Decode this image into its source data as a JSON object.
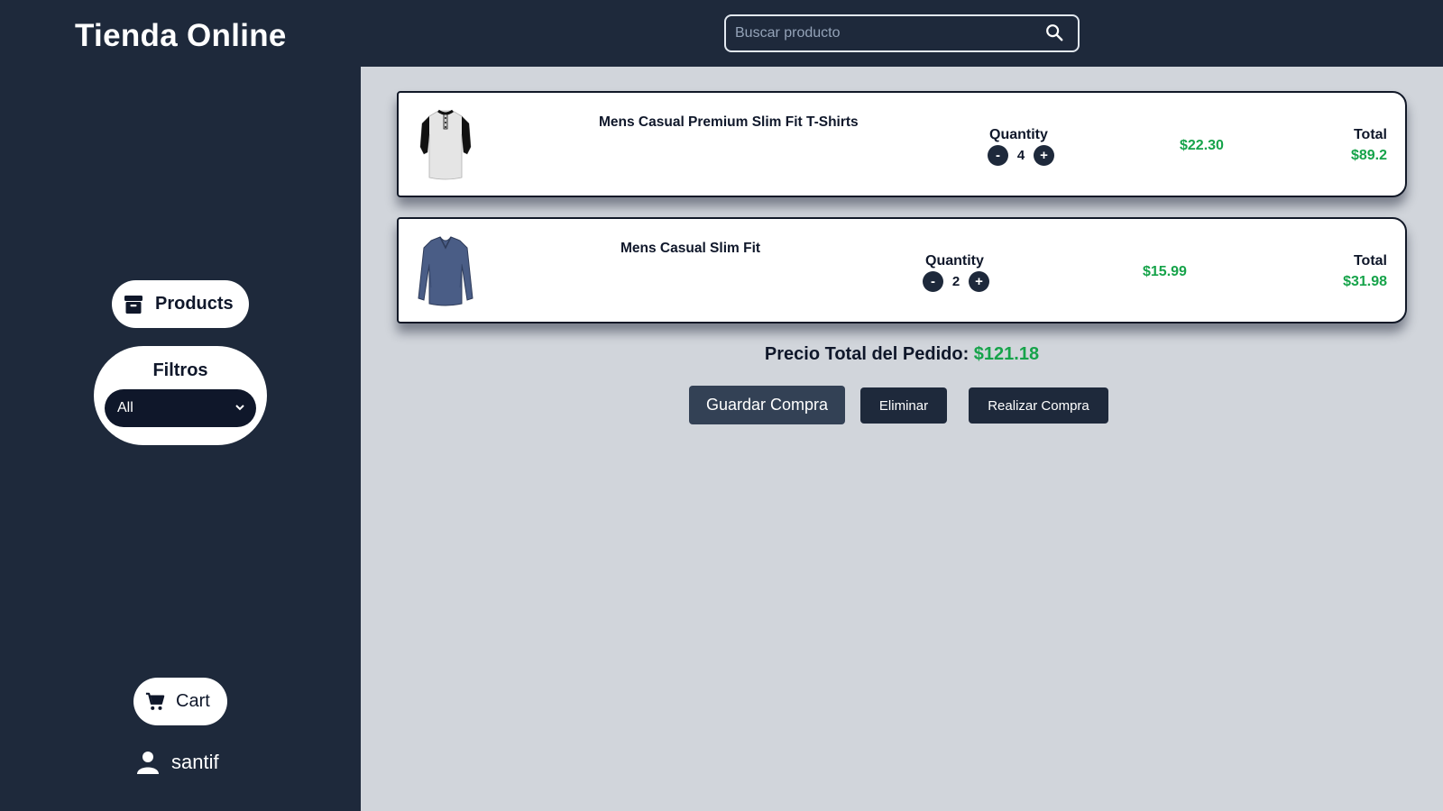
{
  "header": {
    "brand": "Tienda Online",
    "search": {
      "placeholder": "Buscar producto",
      "value": "",
      "icon": "search-icon"
    }
  },
  "sidebar": {
    "products": {
      "label": "Products",
      "icon": "archive-box-icon"
    },
    "filters": {
      "title": "Filtros",
      "selected": "All",
      "options": [
        "All"
      ]
    },
    "cart": {
      "label": "Cart",
      "icon": "cart-icon"
    },
    "user": {
      "name": "santif",
      "icon": "user-icon"
    }
  },
  "cart": {
    "items": [
      {
        "name": "Mens Casual Premium Slim Fit T-Shirts",
        "image": "white-raglan-henley-shirt",
        "quantity_label": "Quantity",
        "quantity": "4",
        "decrement": "-",
        "increment": "+",
        "price": "$22.30",
        "total_label": "Total",
        "total": "$89.2"
      },
      {
        "name": "Mens Casual Slim Fit",
        "image": "blue-long-sleeve-shirt",
        "quantity_label": "Quantity",
        "quantity": "2",
        "decrement": "-",
        "increment": "+",
        "price": "$15.99",
        "total_label": "Total",
        "total": "$31.98"
      }
    ],
    "order_total_label": "Precio Total del Pedido:",
    "order_total": "$121.18",
    "buttons": {
      "save": "Guardar Compra",
      "delete": "Eliminar",
      "checkout": "Realizar Compra"
    }
  },
  "colors": {
    "sidebar_bg": "#1e293b",
    "main_bg": "#d1d5db",
    "price_green": "#16a34a",
    "button_dark": "#1e293b"
  }
}
